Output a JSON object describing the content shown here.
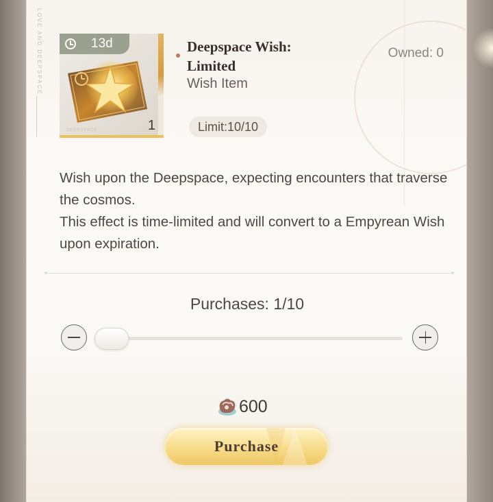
{
  "item": {
    "time_left": "13d",
    "quantity": "1",
    "name": "Deepspace Wish: Limited",
    "type": "Wish Item",
    "owned": "Owned: 0",
    "limit": "Limit:10/10",
    "icon": "deepspace-wish-ticket-icon"
  },
  "description": [
    "Wish upon the Deepspace, expecting encounters that traverse the cosmos.",
    "This effect is time-limited and will convert to a Empyrean Wish upon expiration."
  ],
  "purchase": {
    "purchases_label": "Purchases: 1/10",
    "count": 1,
    "max": 10,
    "price": "600",
    "currency_icon": "gem-currency-icon",
    "button_label": "Purchase"
  },
  "colors": {
    "accent_gold": "#efc766",
    "badge_green": "#9aa18f",
    "dot_red": "#c87467"
  }
}
